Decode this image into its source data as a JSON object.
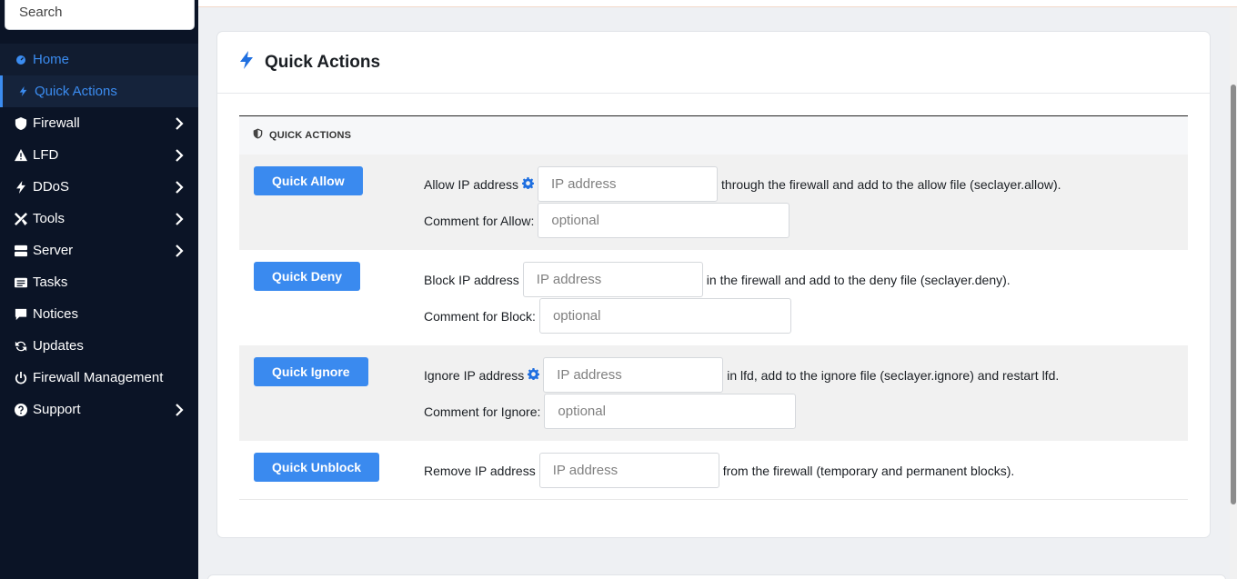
{
  "sidebar": {
    "search_placeholder": "Search",
    "items": [
      {
        "label": "Home"
      },
      {
        "label": "Quick Actions"
      },
      {
        "label": "Firewall"
      },
      {
        "label": "LFD"
      },
      {
        "label": "DDoS"
      },
      {
        "label": "Tools"
      },
      {
        "label": "Server"
      },
      {
        "label": "Tasks"
      },
      {
        "label": "Notices"
      },
      {
        "label": "Updates"
      },
      {
        "label": "Firewall Management"
      },
      {
        "label": "Support"
      }
    ]
  },
  "card": {
    "title": "Quick Actions",
    "section_title": "QUICK ACTIONS"
  },
  "actions": {
    "allow": {
      "button": "Quick Allow",
      "prefix": "Allow IP address",
      "ip_placeholder": "IP address",
      "suffix": "through the firewall and add to the allow file (seclayer.allow).",
      "comment_label": "Comment for Allow:",
      "comment_placeholder": "optional"
    },
    "deny": {
      "button": "Quick Deny",
      "prefix": "Block IP address",
      "ip_placeholder": "IP address",
      "suffix": "in the firewall and add to the deny file (seclayer.deny).",
      "comment_label": "Comment for Block:",
      "comment_placeholder": "optional"
    },
    "ignore": {
      "button": "Quick Ignore",
      "prefix": "Ignore IP address",
      "ip_placeholder": "IP address",
      "suffix": "in lfd, add to the ignore file (seclayer.ignore) and restart lfd.",
      "comment_label": "Comment for Ignore:",
      "comment_placeholder": "optional"
    },
    "unblock": {
      "button": "Quick Unblock",
      "prefix": "Remove IP address",
      "ip_placeholder": "IP address",
      "suffix": "from the firewall (temporary and permanent blocks)."
    }
  },
  "colors": {
    "sidebar_bg": "#0b1426",
    "accent": "#3a8aef",
    "row_shade": "#f1f1f1"
  }
}
